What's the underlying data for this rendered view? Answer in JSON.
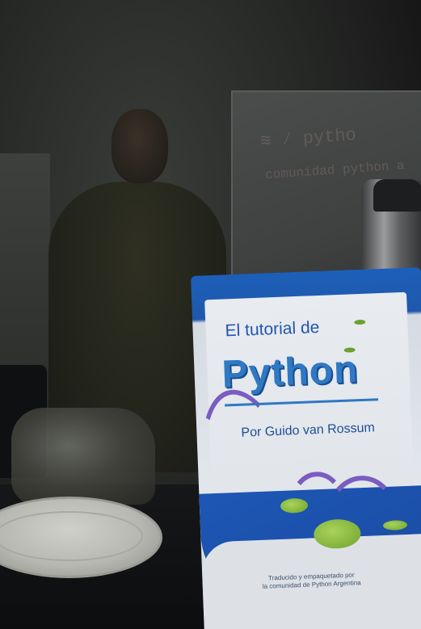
{
  "book": {
    "title_line1": "El tutorial de",
    "title_line2": "Python",
    "author": "Por Guido van Rossum",
    "credit_line1": "Traducido y empaquetado por",
    "credit_line2": "la comunidad de Python Argentina"
  },
  "colors": {
    "book_blue": "#1d57b5",
    "python_title_blue": "#2f78c4",
    "wall_dark": "#262826"
  }
}
